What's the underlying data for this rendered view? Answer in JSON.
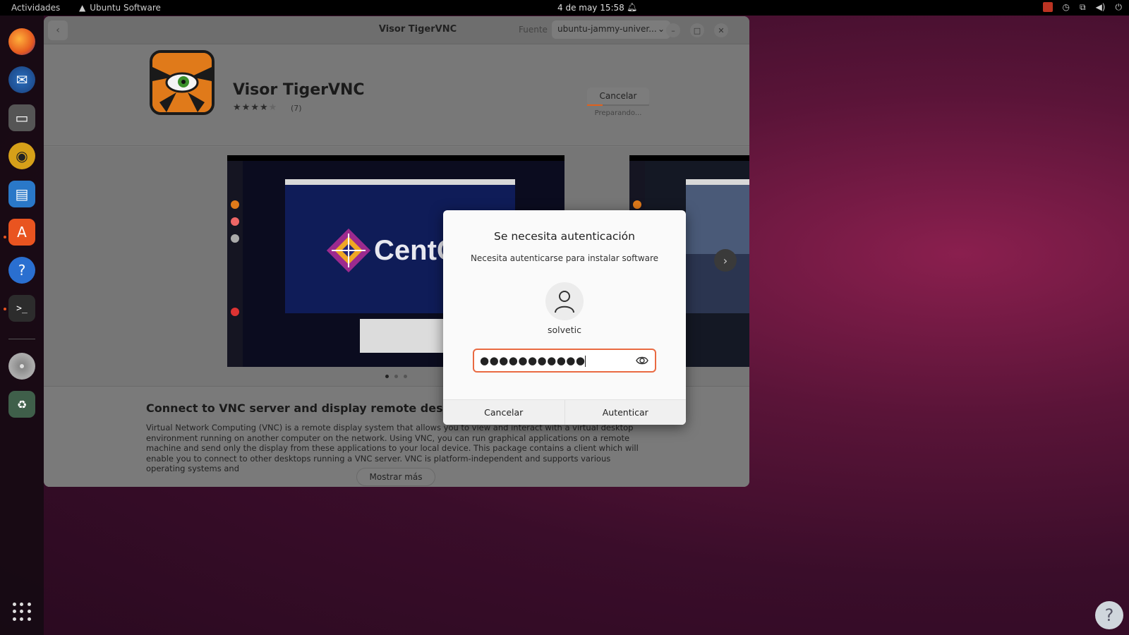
{
  "topbar": {
    "activities": "Actividades",
    "app_name": "Ubuntu Software",
    "clock": "4 de may  15:58"
  },
  "dock": {
    "items": [
      "firefox-icon",
      "thunderbird-icon",
      "files-icon",
      "rhythmbox-icon",
      "writer-icon",
      "software-icon",
      "help-icon",
      "terminal-icon",
      "dvd-icon",
      "trash-icon"
    ]
  },
  "window": {
    "title": "Visor TigerVNC",
    "source_label": "Fuente",
    "source_value": "ubuntu-jammy-univer...",
    "app": {
      "name": "Visor TigerVNC",
      "rating": 3.5,
      "rating_count": "(7)",
      "cancel_label": "Cancelar",
      "status": "Preparando...",
      "progress": 0.25
    },
    "screenshot_text": "CentC",
    "description": {
      "title": "Connect to VNC server and display remote desktop",
      "body": "Virtual Network Computing (VNC) is a remote display system that allows you to view and interact with a virtual desktop environment running on another computer on the network. Using VNC, you can run graphical applications on a remote machine and send only the display from these applications to your local device. This package contains a client which will enable you to connect to other desktops running a VNC server. VNC is platform-independent and supports various operating systems and",
      "more_label": "Mostrar más"
    }
  },
  "dialog": {
    "title": "Se necesita autenticación",
    "subtitle": "Necesita autenticarse para instalar software",
    "username": "solvetic",
    "password_mask": "●●●●●●●●●●●",
    "cancel_label": "Cancelar",
    "auth_label": "Autenticar"
  },
  "colors": {
    "accent": "#e96a42",
    "ubuntu_orange": "#e95420"
  }
}
